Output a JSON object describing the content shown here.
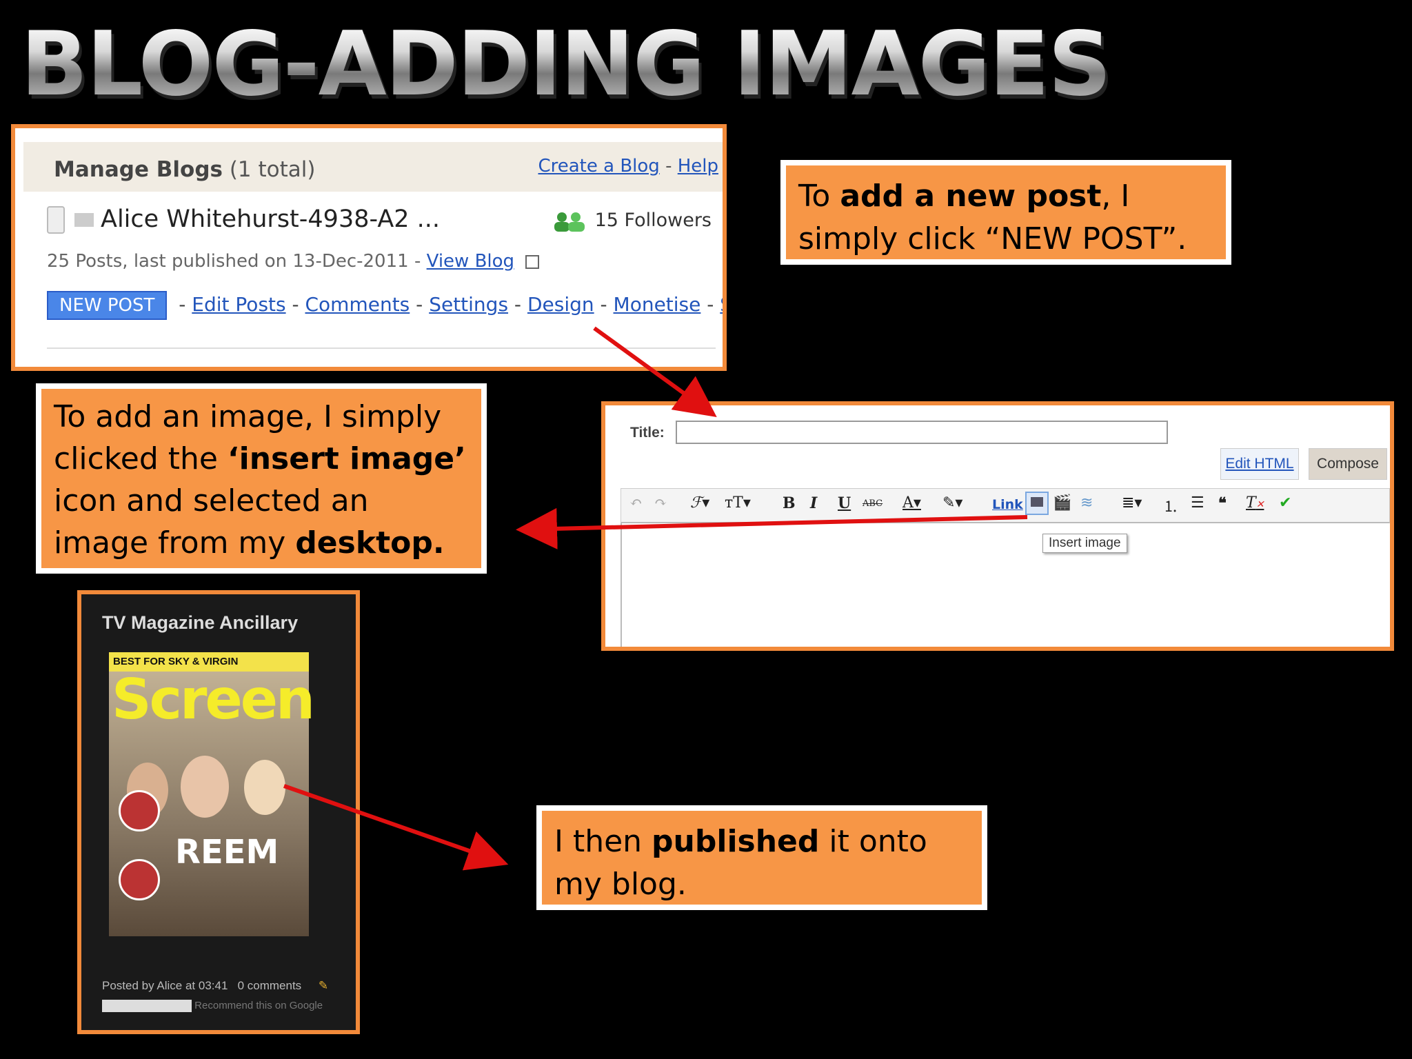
{
  "slide": {
    "title": "BLOG-ADDING IMAGES"
  },
  "manage_blogs": {
    "heading": "Manage Blogs",
    "total": "(1 total)",
    "create_link": "Create a Blog",
    "separator": "-",
    "help_link": "Help",
    "blog_name": "Alice Whitehurst-4938-A2 ...",
    "followers": "15 Followers",
    "meta": "25 Posts, last published on 13-Dec-2011 -",
    "view_blog": "View Blog",
    "actions": {
      "new_post": "NEW POST",
      "edit_posts": "Edit Posts",
      "comments": "Comments",
      "settings": "Settings",
      "design": "Design",
      "monetise": "Monetise",
      "stats": "Stats"
    }
  },
  "callouts": {
    "c1": {
      "pre": "To ",
      "bold": "add a new post",
      "post": ", I simply click “NEW POST”."
    },
    "c2": {
      "pre": "To add an image, I simply clicked the ",
      "bold1": "‘insert image’",
      "mid": " icon and selected an image from my ",
      "bold2": "desktop."
    },
    "c3": {
      "pre": "I then ",
      "bold": "published",
      "post": " it onto my blog."
    }
  },
  "editor": {
    "title_label": "Title:",
    "title_value": "",
    "edit_html_tab": "Edit HTML",
    "compose_tab": "Compose",
    "link_label": "Link",
    "tooltip": "Insert image"
  },
  "magazine": {
    "title": "TV Magazine Ancillary",
    "cover_banner": "BEST FOR SKY & VIRGIN",
    "cover_title": "Screen",
    "cover_name": "REEM",
    "posted": "Posted by Alice at 03:41",
    "comments": "0 comments",
    "recommend": "Recommend this on Google"
  },
  "colors": {
    "accent_orange": "#f79646",
    "border_orange": "#f28a3a",
    "arrow_red": "#e01010",
    "link_blue": "#2255bb"
  }
}
